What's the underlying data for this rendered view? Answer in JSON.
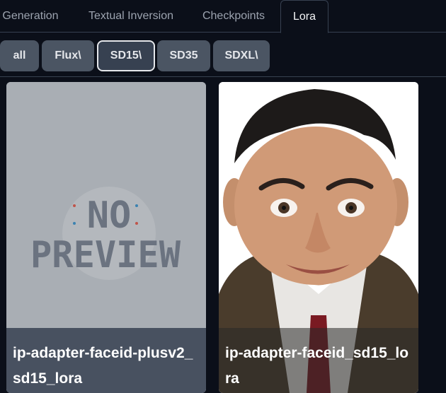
{
  "tabs": [
    {
      "label": "Generation"
    },
    {
      "label": "Textual Inversion"
    },
    {
      "label": "Checkpoints"
    },
    {
      "label": "Lora"
    }
  ],
  "active_tab": "Lora",
  "filters": [
    {
      "label": "all"
    },
    {
      "label": "Flux\\"
    },
    {
      "label": "SD15\\"
    },
    {
      "label": "SD35"
    },
    {
      "label": "SDXL\\"
    }
  ],
  "selected_filter": "SD15\\",
  "cards": [
    {
      "title": "ip-adapter-faceid-plusv2_sd15_lora",
      "image": "NO PREVIEW",
      "image_text_line1": "NO",
      "image_text_line2": "PREVIEW"
    },
    {
      "title": "ip-adapter-faceid_sd15_lora",
      "image": "portrait-photo"
    }
  ]
}
